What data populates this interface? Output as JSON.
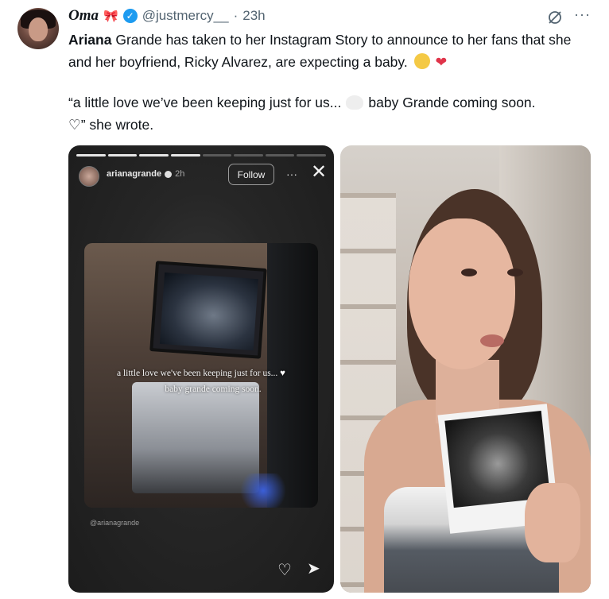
{
  "tweet": {
    "display_name": "Oma",
    "handle": "@justmercy__",
    "separator": "·",
    "time": "23h",
    "more_label": "···",
    "line1_bold": "Ariana",
    "line1_rest": "Grande has taken to her Instagram Story to announce to her fans that she and her boyfriend, Ricky Alvarez, are expecting a baby.",
    "quote_start": "“a little love we’ve been keeping just for us...",
    "quote_end": "baby Grande coming soon.",
    "quote_tail": "♡” she wrote."
  },
  "story": {
    "username": "arianagrande",
    "time": "2h",
    "follow_label": "Follow",
    "more_label": "···",
    "close_label": "✕",
    "caption_line1": "a little love we've been keeping just for us...",
    "caption_heart": "♥",
    "caption_line2": "baby grande coming soon.",
    "tag": "@arianagrande",
    "heart_icon": "♡",
    "send_icon": "➤"
  },
  "icons": {
    "verified": "✓",
    "bow": "🎀",
    "heart": "❤"
  },
  "colors": {
    "verified_blue": "#1d9bf0",
    "heart_red": "#e0344a"
  }
}
